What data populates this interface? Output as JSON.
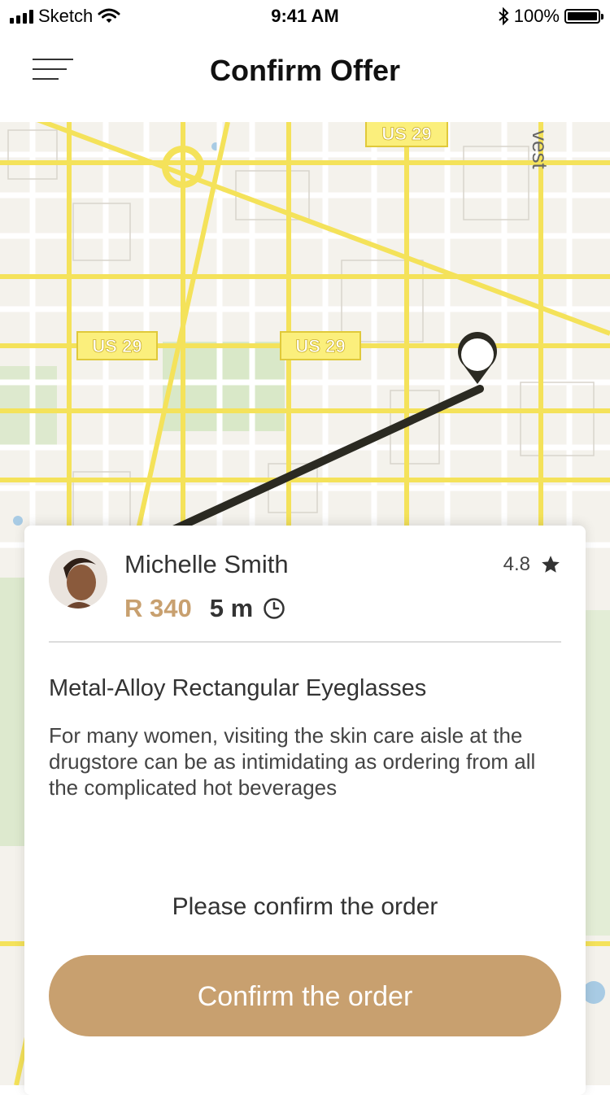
{
  "status_bar": {
    "carrier": "Sketch",
    "time": "9:41 AM",
    "battery": "100%",
    "battery_level": 1.0
  },
  "nav": {
    "title": "Confirm Offer",
    "menu_icon": "hamburger-menu-icon"
  },
  "map": {
    "route_labels": [
      "US 29",
      "US 29",
      "US 29"
    ],
    "street_fragment": "vest",
    "route_color": "#2b2a22",
    "road_color": "#f4e25a"
  },
  "offer": {
    "driver_name": "Michelle Smith",
    "rating": "4.8",
    "rating_icon": "star-icon",
    "price": "R 340",
    "eta": "5 m",
    "eta_icon": "clock-icon",
    "product_title": "Metal-Alloy Rectangular Eyeglasses",
    "product_description": "For many women, visiting the skin care aisle at the drugstore can be as intimidating as ordering from all the complicated hot beverages",
    "confirm_prompt": "Please confirm the order",
    "confirm_button_label": "Confirm the order",
    "accent_color": "#c8a06f"
  }
}
